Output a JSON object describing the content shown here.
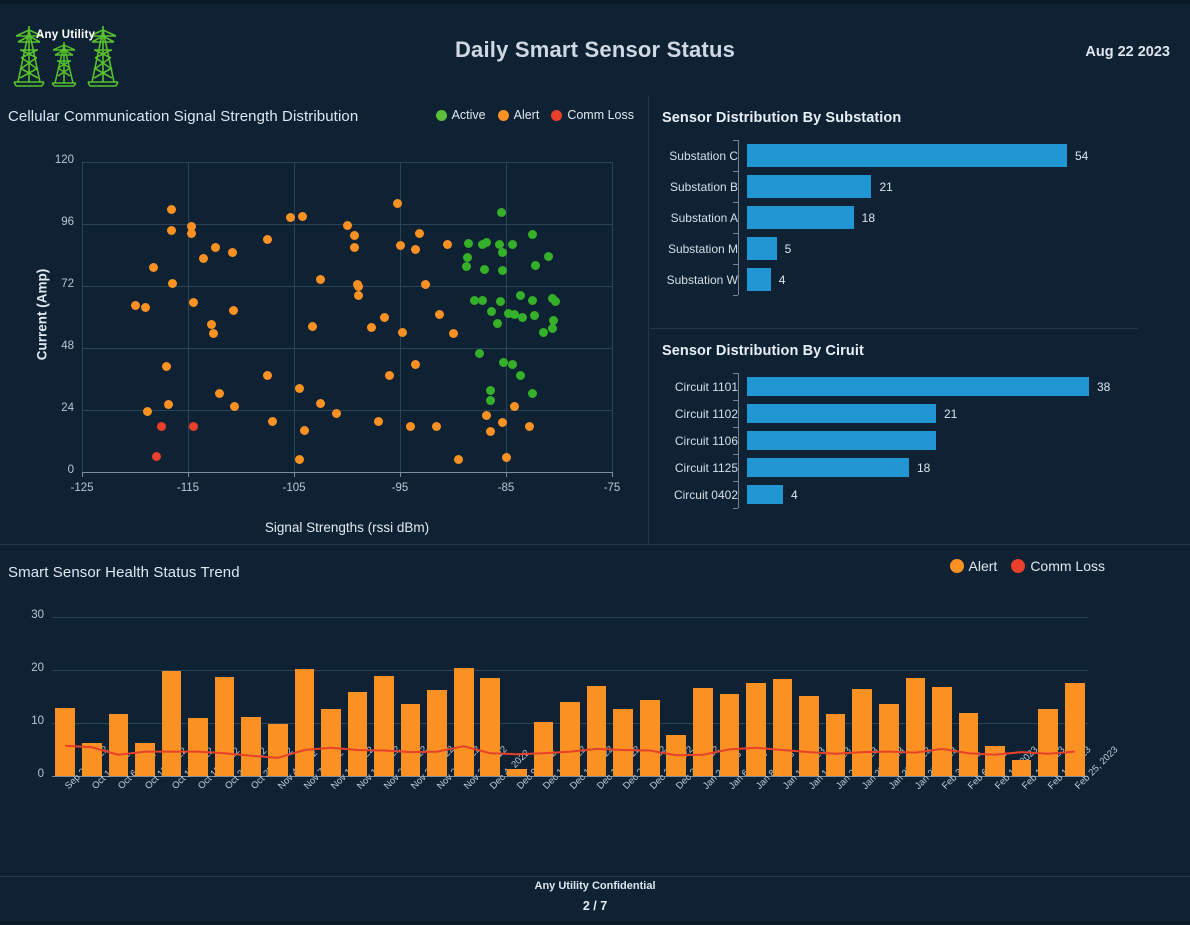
{
  "brand": {
    "name": "Any Utility",
    "logo_icon": "transmission-towers-icon",
    "color": "#57c22d"
  },
  "header": {
    "title": "Daily Smart Sensor Status",
    "date": "Aug 22 2023"
  },
  "footer": {
    "confidential": "Any Utility Confidential",
    "page": "2 / 7"
  },
  "colors": {
    "background": "#0f2233",
    "active": "#35b029",
    "alert": "#fb9122",
    "comm_loss": "#e8402a",
    "bar_blue": "#2196d3",
    "trend_line": "#e8402a"
  },
  "scatter": {
    "title": "Cellular Communication Signal Strength Distribution",
    "legend": [
      {
        "label": "Active",
        "color": "#5cbf3a",
        "icon": "legend-dot-icon"
      },
      {
        "label": "Alert",
        "color": "#fb9122",
        "icon": "legend-dot-icon"
      },
      {
        "label": "Comm Loss",
        "color": "#e8402a",
        "icon": "legend-dot-icon"
      }
    ]
  },
  "substation": {
    "title": "Sensor Distribution By Substation"
  },
  "circuit": {
    "title": "Sensor Distribution By Ciruit"
  },
  "trend": {
    "title": "Smart Sensor Health Status Trend",
    "legend": [
      {
        "label": "Alert",
        "color": "#fb9122",
        "icon": "legend-dot-icon"
      },
      {
        "label": "Comm Loss",
        "color": "#e8402a",
        "icon": "legend-dot-icon"
      }
    ]
  },
  "chart_data": [
    {
      "type": "scatter",
      "title": "Cellular Communication Signal Strength Distribution",
      "xlabel": "Signal Strengths (rssi dBm)",
      "ylabel": "Current (Amp)",
      "xlim": [
        -125,
        -75
      ],
      "ylim": [
        0,
        120
      ],
      "xticks": [
        -125,
        -115,
        -105,
        -95,
        -85,
        -75
      ],
      "yticks": [
        0,
        24,
        48,
        72,
        96,
        120
      ],
      "grid": true,
      "legend_position": "top-right",
      "series": [
        {
          "name": "Active",
          "color": "#35b029",
          "points": [
            [
              -85.4,
              100.5
            ],
            [
              -82.5,
              92.0
            ],
            [
              -86.8,
              89.0
            ],
            [
              -88.5,
              88.5
            ],
            [
              -87.2,
              88.0
            ],
            [
              -85.6,
              88.0
            ],
            [
              -84.4,
              88.0
            ],
            [
              -81.0,
              83.5
            ],
            [
              -88.6,
              83.0
            ],
            [
              -85.3,
              85.0
            ],
            [
              -88.7,
              79.5
            ],
            [
              -87.0,
              78.5
            ],
            [
              -85.3,
              78.0
            ],
            [
              -82.2,
              80.0
            ],
            [
              -83.6,
              68.5
            ],
            [
              -88.0,
              66.5
            ],
            [
              -87.2,
              66.5
            ],
            [
              -85.5,
              66.0
            ],
            [
              -82.5,
              66.5
            ],
            [
              -80.6,
              67.0
            ],
            [
              -80.3,
              66.0
            ],
            [
              -86.4,
              62.0
            ],
            [
              -84.8,
              61.5
            ],
            [
              -84.2,
              61.0
            ],
            [
              -83.4,
              60.0
            ],
            [
              -82.3,
              60.5
            ],
            [
              -80.5,
              58.5
            ],
            [
              -80.6,
              55.5
            ],
            [
              -85.8,
              57.5
            ],
            [
              -81.5,
              54.0
            ],
            [
              -87.5,
              46.0
            ],
            [
              -85.2,
              42.5
            ],
            [
              -84.4,
              41.5
            ],
            [
              -83.6,
              37.5
            ],
            [
              -86.5,
              31.5
            ],
            [
              -86.5,
              27.5
            ],
            [
              -82.5,
              30.5
            ]
          ]
        },
        {
          "name": "Alert",
          "color": "#fb9122",
          "points": [
            [
              -95.2,
              104.0
            ],
            [
              -116.6,
              101.5
            ],
            [
              -105.3,
              98.5
            ],
            [
              -104.2,
              99.0
            ],
            [
              -116.6,
              93.5
            ],
            [
              -114.7,
              95.0
            ],
            [
              -114.7,
              92.5
            ],
            [
              -100.0,
              95.5
            ],
            [
              -107.5,
              90.0
            ],
            [
              -99.3,
              91.5
            ],
            [
              -99.3,
              87.0
            ],
            [
              -93.2,
              92.5
            ],
            [
              -112.4,
              87.0
            ],
            [
              -110.8,
              85.0
            ],
            [
              -113.5,
              82.5
            ],
            [
              -118.3,
              79.0
            ],
            [
              -95.0,
              87.5
            ],
            [
              -93.5,
              86.0
            ],
            [
              -90.5,
              88.0
            ],
            [
              -116.5,
              73.0
            ],
            [
              -99.0,
              72.5
            ],
            [
              -102.5,
              74.5
            ],
            [
              -92.6,
              72.5
            ],
            [
              -120.0,
              64.5
            ],
            [
              -119.0,
              63.5
            ],
            [
              -114.5,
              65.5
            ],
            [
              -98.9,
              72.0
            ],
            [
              -98.9,
              68.5
            ],
            [
              -110.7,
              62.5
            ],
            [
              -112.8,
              57.0
            ],
            [
              -112.6,
              53.5
            ],
            [
              -96.5,
              60.0
            ],
            [
              -103.3,
              56.5
            ],
            [
              -97.7,
              56.0
            ],
            [
              -94.8,
              54.0
            ],
            [
              -91.3,
              61.0
            ],
            [
              -90.0,
              53.5
            ],
            [
              -117.0,
              41.0
            ],
            [
              -107.5,
              37.5
            ],
            [
              -104.5,
              32.5
            ],
            [
              -96.0,
              37.5
            ],
            [
              -93.5,
              41.5
            ],
            [
              -112.0,
              30.5
            ],
            [
              -110.6,
              25.5
            ],
            [
              -102.5,
              26.5
            ],
            [
              -118.8,
              23.5
            ],
            [
              -116.8,
              26.0
            ],
            [
              -101.0,
              22.5
            ],
            [
              -97.0,
              19.5
            ],
            [
              -94.0,
              17.5
            ],
            [
              -91.6,
              17.5
            ],
            [
              -86.8,
              22.0
            ],
            [
              -85.3,
              19.0
            ],
            [
              -84.2,
              25.5
            ],
            [
              -82.8,
              17.5
            ],
            [
              -104.5,
              5.0
            ],
            [
              -89.5,
              5.0
            ],
            [
              -85.0,
              5.5
            ],
            [
              -86.5,
              15.5
            ],
            [
              -104.0,
              16.0
            ],
            [
              -107.0,
              19.5
            ]
          ]
        },
        {
          "name": "Comm Loss",
          "color": "#e8402a",
          "points": [
            [
              -117.5,
              17.5
            ],
            [
              -114.5,
              17.5
            ],
            [
              -118.0,
              6.0
            ]
          ]
        }
      ]
    },
    {
      "type": "bar",
      "orientation": "horizontal",
      "title": "Sensor Distribution By Substation",
      "categories": [
        "Substation  C",
        "Substation  B",
        "Substation  A",
        "Substation  M",
        "Substation  W"
      ],
      "values": [
        54,
        21,
        18,
        5,
        4
      ],
      "value_labels": [
        "54",
        "21",
        "18",
        "5",
        "4"
      ],
      "color": "#2196d3",
      "xlabel": "",
      "ylabel": "",
      "grid": false
    },
    {
      "type": "bar",
      "orientation": "horizontal",
      "title": "Sensor Distribution By Ciruit",
      "categories": [
        "Circuit 1101",
        "Circuit 1102",
        "Circuit 1106",
        "Circuit 1125",
        "Circuit 0402"
      ],
      "values": [
        38,
        21,
        21,
        18,
        4
      ],
      "value_labels": [
        "38",
        "21",
        "",
        "18",
        "4"
      ],
      "color": "#2196d3",
      "xlabel": "",
      "ylabel": "",
      "grid": false
    },
    {
      "type": "bar",
      "title": "Smart Sensor Health Status Trend",
      "xlabel": "",
      "ylabel": "",
      "ylim": [
        0,
        32
      ],
      "yticks": [
        0,
        10,
        20,
        30
      ],
      "grid": true,
      "legend_position": "top-right",
      "categories": [
        "Sep 29, 2022",
        "Oct 1, 2022",
        "Oct 6, 2022",
        "Oct 12, 2022",
        "Oct 17, 2022",
        "Oct 19, 2022",
        "Oct 25, 2022",
        "Oct 29, 2022",
        "Nov 4, 2022",
        "Nov 7, 2022",
        "Nov 11, 2022",
        "Nov 16, 2022",
        "Nov 21, 2022",
        "Nov 23, 2022",
        "Nov 26, 2022",
        "Nov 29, 2022",
        "Dec 4, 2022",
        "Dec 9, 2022",
        "Dec 13, 2022",
        "Dec 16, 2022",
        "Dec 18, 2022",
        "Dec 23, 2022",
        "Dec 26, 2022",
        "Dec 30, 2022",
        "Jan 2, 2023",
        "Jan 6, 2023",
        "Jan 8, 2023",
        "Jan 10, 2023",
        "Jan 16, 2023",
        "Jan 22, 2023",
        "Jan 25, 2023",
        "Jan 27, 2023",
        "Jan 29, 2023",
        "Feb 3, 2023",
        "Feb 6, 2023",
        "Feb 10, 2023",
        "Feb 13, 2023",
        "Feb 18, 2023",
        "Feb 25, 2023"
      ],
      "series": [
        {
          "name": "Alert",
          "type": "bar",
          "color": "#fb9122",
          "values": [
            12.8,
            6.3,
            11.7,
            6.3,
            19.8,
            11.0,
            18.6,
            11.2,
            9.7,
            20.2,
            12.6,
            15.9,
            18.8,
            13.5,
            16.1,
            20.4,
            18.4,
            1.3,
            10.2,
            14.0,
            17.0,
            12.6,
            14.4,
            7.8,
            16.6,
            15.4,
            17.6,
            18.3,
            15.0,
            11.7,
            16.4,
            13.6,
            18.4,
            16.8,
            11.8,
            5.7,
            3.1,
            12.7,
            17.5
          ]
        },
        {
          "name": "Comm Loss",
          "type": "line",
          "color": "#e8402a",
          "values": [
            5.7,
            5.4,
            4.0,
            4.6,
            4.6,
            4.6,
            4.3,
            3.8,
            3.4,
            4.9,
            5.3,
            4.9,
            4.8,
            4.5,
            4.6,
            5.6,
            4.3,
            4.1,
            4.3,
            4.6,
            5.1,
            4.9,
            4.8,
            3.9,
            4.0,
            5.0,
            5.3,
            4.9,
            4.5,
            4.2,
            4.5,
            4.6,
            4.4,
            5.1,
            4.3,
            4.0,
            4.5,
            4.2,
            4.6
          ]
        }
      ]
    }
  ]
}
